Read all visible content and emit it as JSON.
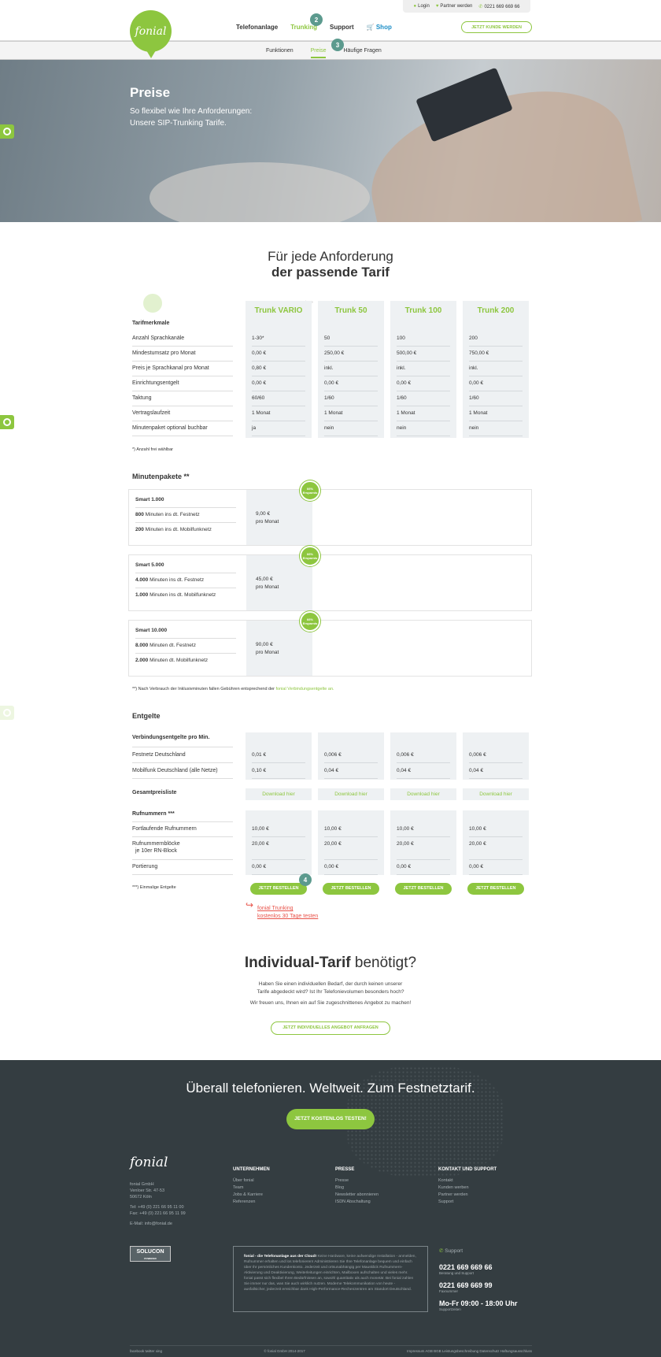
{
  "util": {
    "login": "Login",
    "partner": "Partner werden",
    "phone": "0221 669 669 66"
  },
  "logo": "fonial",
  "nav": [
    "Telefonanlage",
    "Trunking",
    "Support",
    "Shop"
  ],
  "cta_header": "JETZT KUNDE WERDEN",
  "badges": [
    "2",
    "3",
    "4"
  ],
  "subnav": [
    "Funktionen",
    "Preise",
    "Häufige Fragen"
  ],
  "hero": {
    "title": "Preise",
    "line1": "So flexibel wie Ihre Anforderungen:",
    "line2": "Unsere SIP-Trunking Tarife."
  },
  "section1": {
    "line1": "Für jede Anforderung",
    "line2": "der passende Tarif"
  },
  "small_tabs": [
    "Kontakt-ue",
    "Trunking",
    "Preise"
  ],
  "tarif_header": "Tarifmerkmale",
  "tariffs": [
    "Trunk VARIO",
    "Trunk 50",
    "Trunk 100",
    "Trunk 200"
  ],
  "features": [
    {
      "label": "Anzahl Sprachkanäle",
      "values": [
        "1-30*",
        "50",
        "100",
        "200"
      ]
    },
    {
      "label": "Mindestumsatz pro Monat",
      "values": [
        "0,00 €",
        "250,00 €",
        "500,00 €",
        "750,00 €"
      ]
    },
    {
      "label": "Preis je Sprachkanal pro Monat",
      "values": [
        "0,80 €",
        "inkl.",
        "inkl.",
        "inkl."
      ]
    },
    {
      "label": "Einrichtungsentgelt",
      "values": [
        "0,00 €",
        "0,00 €",
        "0,00 €",
        "0,00 €"
      ]
    },
    {
      "label": "Taktung",
      "values": [
        "60/60",
        "1/60",
        "1/60",
        "1/60"
      ]
    },
    {
      "label": "Vertragslaufzeit",
      "values": [
        "1 Monat",
        "1 Monat",
        "1 Monat",
        "1 Monat"
      ]
    },
    {
      "label": "Minutenpaket optional buchbar",
      "values": [
        "ja",
        "nein",
        "nein",
        "nein"
      ]
    }
  ],
  "note1": "*) Anzahl frei wählbar",
  "minuten_title": "Minutenpakete **",
  "saving": "66% Ersparnis",
  "packages": [
    {
      "name": "Smart 1.000",
      "l1b": "800",
      "l1": " Minuten ins dt. Festnetz",
      "l2b": "200",
      "l2": " Minuten ins dt. Mobilfunknetz",
      "price": "9,00 €",
      "per": "pro Monat"
    },
    {
      "name": "Smart 5.000",
      "l1b": "4.000",
      "l1": " Minuten ins dt. Festnetz",
      "l2b": "1.000",
      "l2": " Minuten ins dt. Mobilfunknetz",
      "price": "45,00 €",
      "per": "pro Monat"
    },
    {
      "name": "Smart 10.000",
      "l1b": "8.000",
      "l1": " Minuten dt. Festnetz",
      "l2b": "2.000",
      "l2": " Minuten dt. Mobilfunknetz",
      "price": "90,00 €",
      "per": "pro Monat"
    }
  ],
  "note2a": "**) Nach Verbrauch der Inklusivminuten fallen Gebühren entsprechend der ",
  "note2link": "fonial Verbindungsentgelte an.",
  "entgelte_title": "Entgelte",
  "verb_title": "Verbindungsentgelte pro Min.",
  "verb": [
    {
      "label": "Festnetz Deutschland",
      "values": [
        "0,01 €",
        "0,006 €",
        "0,006 €",
        "0,006 €"
      ]
    },
    {
      "label": "Mobilfunk Deutschland (alle Netze)",
      "values": [
        "0,10 €",
        "0,04 €",
        "0,04 €",
        "0,04 €"
      ]
    }
  ],
  "gesamt_title": "Gesamtpreisliste",
  "download": "Download hier",
  "rufnr_title": "Rufnummern ***",
  "rufnr": [
    {
      "label": "Fortlaufende Rufnummern",
      "label2": "",
      "values": [
        "10,00 €",
        "10,00 €",
        "10,00 €",
        "10,00 €"
      ]
    },
    {
      "label": "Rufnummernblöcke",
      "label2": "je 10er RN-Block",
      "values": [
        "20,00 €",
        "20,00 €",
        "20,00 €",
        "20,00 €"
      ]
    },
    {
      "label": "Portierung",
      "label2": "",
      "values": [
        "0,00 €",
        "0,00 €",
        "0,00 €",
        "0,00 €"
      ]
    }
  ],
  "note3": "***) Einmalige Entgelte",
  "order": "JETZT BESTELLEN",
  "trial1": "fonial Trunking",
  "trial2": "kostenlos 30 Tage testen",
  "individual": {
    "bold": "Individual-Tarif",
    "rest": " benötigt?",
    "p1a": "Haben Sie einen individuellen Bedarf, der durch keinen unserer",
    "p1b": "Tarife abgedeckt wird? Ist Ihr Telefonievolumen besonders hoch?",
    "p2": "Wir freuen uns, Ihnen ein auf Sie zugeschnittenes Angebot zu machen!",
    "cta": "JETZT INDIVIDUELLES ANGEBOT ANFRAGEN"
  },
  "footer": {
    "title": "Überall telefonieren. Weltweit. Zum Festnetztarif.",
    "cta": "JETZT KOSTENLOS TESTEN!",
    "logo": "fonial",
    "address": [
      "fonial GmbH",
      "Venloer Str. 47-53",
      "50672 Köln",
      "",
      "Tel: +49 (0) 221 66 95 11 00",
      "Fax: +49 (0) 221 66 95 11 99",
      "",
      "E-Mail: info@fonial.de"
    ],
    "cols": [
      {
        "title": "UNTERNEHMEN",
        "items": [
          "Über fonial",
          "Team",
          "Jobs & Karriere",
          "Referenzen"
        ]
      },
      {
        "title": "PRESSE",
        "items": [
          "Presse",
          "Blog",
          "Newsletter abonnieren",
          "ISDN Abschaltung"
        ]
      },
      {
        "title": "KONTAKT UND SUPPORT",
        "items": [
          "Kontakt",
          "Kunden werben",
          "Partner werden",
          "Support"
        ]
      }
    ],
    "solucon": "SOLUCON",
    "solucon_sub": "POWERED",
    "about_bold": "fonial - die Telefonanlage aus der Cloud!",
    "about": " Keine Hardware, keine aufwendige Installation - anmelden, Rufnummer erhalten und los telefonieren! Administrieren Sie Ihre Telefonanlage bequem und einfach über Ihr persönliches Kundenkonto. Jederzeit und ortsunabhängig per Mausklick Rufnummern-Aktivierung und Deaktivierung, Weiterleitungen einrichten, Mailboxen aufschalten und vieles mehr. fonial passt sich flexibel Ihren Bedürfnissen an, sowohl quantitativ als auch monetär. Bei fonial zahlen Sie immer nur das, was Sie auch wirklich nutzen. Moderne Telekommunikation von heute - ausfallsicher, jederzeit erreichbar dank High-Performance-Rechenzentren am Standort Deutschland.",
    "support_title": "Support",
    "num1": "0221 669 669 66",
    "num1sub": "Beratung und Support",
    "num2": "0221 669 669 99",
    "num2sub": "Faxnummer",
    "hours": "Mo-Fr 09:00 - 18:00 Uhr",
    "hourssub": "Supportzeiten",
    "social": "facebook   twitter   xing",
    "copy": "© fonial GmbH 2014-2017",
    "legal": "Impressum   AGB   BGB   Leistungsbeschreibung   Datenschutz   Haftungsausschluss"
  }
}
